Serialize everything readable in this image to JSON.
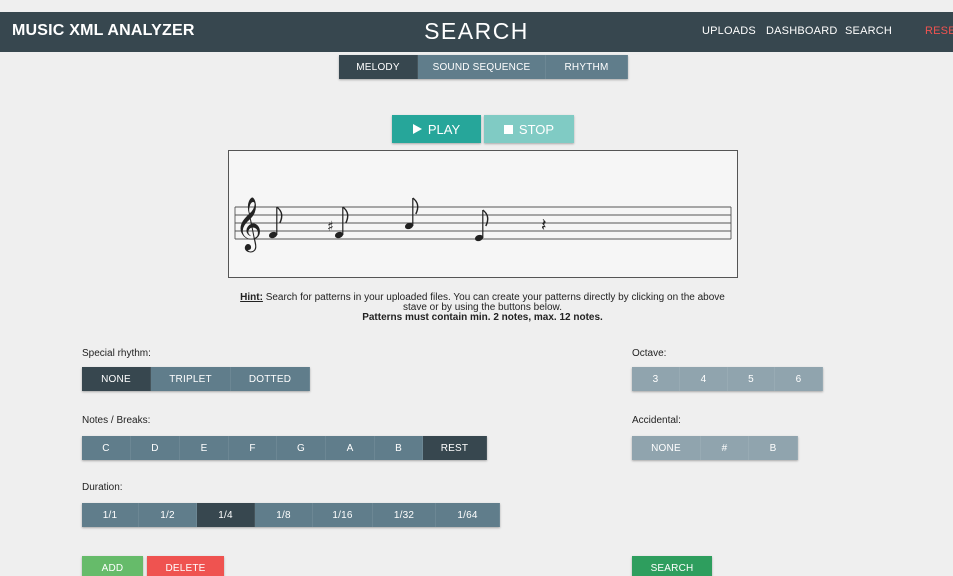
{
  "header": {
    "brand": "MUSIC XML ANALYZER",
    "title": "SEARCH",
    "nav": [
      "UPLOADS",
      "DASHBOARD",
      "SEARCH",
      "RESET"
    ]
  },
  "tabs": [
    {
      "label": "MELODY",
      "active": true
    },
    {
      "label": "SOUND SEQUENCE",
      "active": false
    },
    {
      "label": "RHYTHM",
      "active": false
    }
  ],
  "player": {
    "play_label": "PLAY",
    "stop_label": "STOP"
  },
  "stave": {
    "clef": "treble",
    "notes": [
      "1/8 note",
      "sharp 1/8 note",
      "1/8 note",
      "1/8 note",
      "quarter rest"
    ]
  },
  "hint": {
    "label": "Hint:",
    "text": "Search for patterns in your uploaded files. You can create your patterns directly by clicking on the above stave or by using the buttons below.",
    "rule": "Patterns must contain min. 2 notes, max. 12 notes."
  },
  "special_rhythm": {
    "label": "Special rhythm:",
    "options": [
      "NONE",
      "TRIPLET",
      "DOTTED"
    ],
    "selected": "NONE"
  },
  "notes_breaks": {
    "label": "Notes / Breaks:",
    "options": [
      "C",
      "D",
      "E",
      "F",
      "G",
      "A",
      "B",
      "REST"
    ],
    "selected": "REST"
  },
  "duration": {
    "label": "Duration:",
    "options": [
      "1/1",
      "1/2",
      "1/4",
      "1/8",
      "1/16",
      "1/32",
      "1/64"
    ],
    "selected": "1/4"
  },
  "octave": {
    "label": "Octave:",
    "options": [
      "3",
      "4",
      "5",
      "6"
    ]
  },
  "accidental": {
    "label": "Accidental:",
    "options": [
      "NONE",
      "#",
      "B"
    ]
  },
  "actions": {
    "add": "ADD",
    "delete": "DELETE",
    "search": "SEARCH"
  },
  "colors": {
    "header_bg": "#37474f",
    "button_bg": "#607d8b",
    "button_disabled_bg": "#90a4ae",
    "active_bg": "#37474f",
    "play": "#26a69a",
    "stop": "#80cbc4",
    "add": "#66bb6a",
    "delete": "#ef5350",
    "search": "#2e9e5e",
    "reset_link": "#ef5350"
  }
}
